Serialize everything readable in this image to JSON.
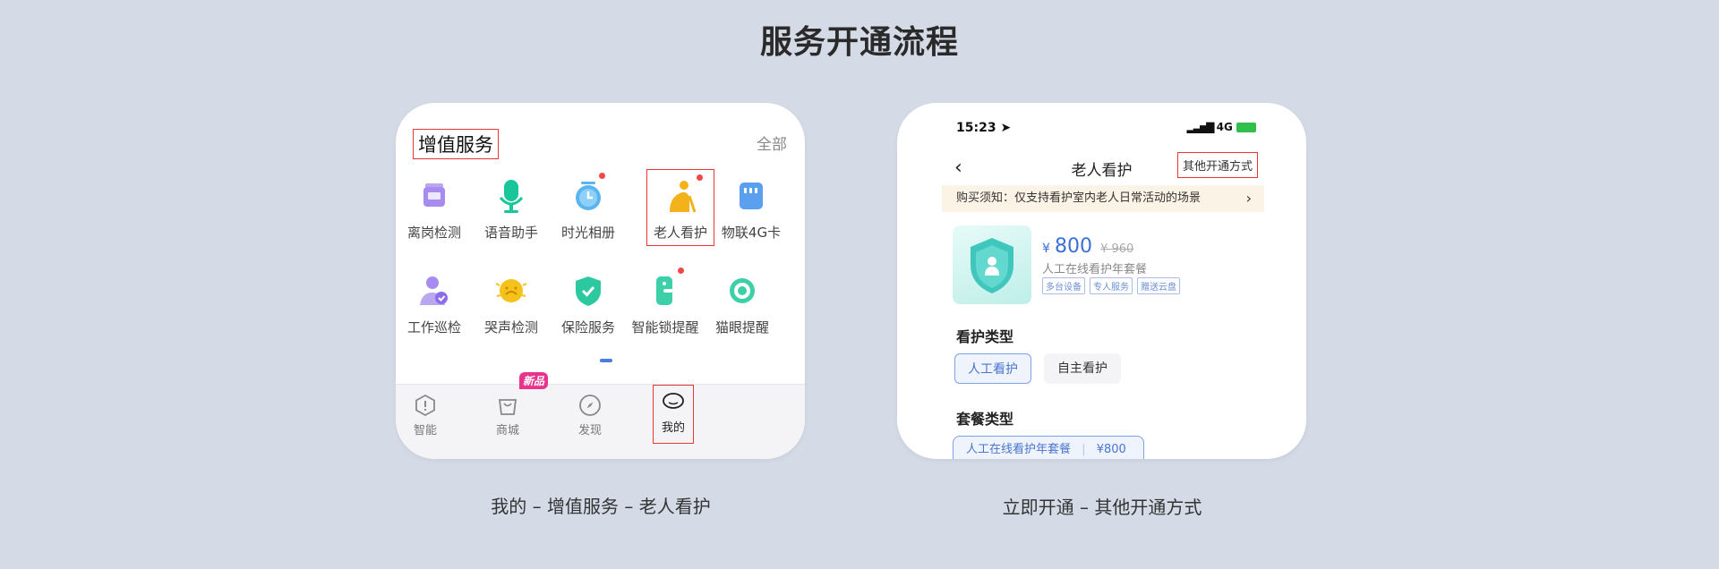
{
  "title": "服务开通流程",
  "left": {
    "section_title": "增值服务",
    "all_label": "全部",
    "items": [
      {
        "label": "离岗检测",
        "icon": "monitor-icon"
      },
      {
        "label": "语音助手",
        "icon": "microphone-icon"
      },
      {
        "label": "时光相册",
        "icon": "clock-icon"
      },
      {
        "label": "老人看护",
        "icon": "elder-icon"
      },
      {
        "label": "物联4G卡",
        "icon": "sim-card-icon"
      },
      {
        "label": "工作巡检",
        "icon": "person-check-icon"
      },
      {
        "label": "哭声检测",
        "icon": "baby-cry-icon"
      },
      {
        "label": "保险服务",
        "icon": "shield-check-icon"
      },
      {
        "label": "智能锁提醒",
        "icon": "smart-lock-icon"
      },
      {
        "label": "猫眼提醒",
        "icon": "peephole-icon"
      }
    ],
    "tabs": [
      {
        "label": "智能",
        "icon": "hexagon-alert-icon"
      },
      {
        "label": "商城",
        "icon": "shopping-bag-icon"
      },
      {
        "label": "发现",
        "icon": "compass-icon"
      },
      {
        "label": "我的",
        "icon": "profile-icon"
      }
    ],
    "new_badge": "新品"
  },
  "right": {
    "time": "15:23",
    "network": "4G",
    "nav_title": "老人看护",
    "other_methods": "其他开通方式",
    "notice": "购买须知：仅支持看护室内老人日常活动的场景",
    "currency": "¥",
    "price": "800",
    "old_price": "¥ 960",
    "product_name": "人工在线看护年套餐",
    "tags": [
      "多台设备",
      "专人服务",
      "赠送云盘"
    ],
    "care_type_label": "看护类型",
    "care_types": [
      "人工看护",
      "自主看护"
    ],
    "package_type_label": "套餐类型",
    "package_name": "人工在线看护年套餐",
    "package_price": "¥800"
  },
  "captions": {
    "left": "我的 – 增值服务 – 老人看护",
    "right": "立即开通 – 其他开通方式"
  },
  "colors": {
    "background": "#d4dbe7",
    "accent": "#3a6fd8",
    "highlight": "#e53935"
  }
}
